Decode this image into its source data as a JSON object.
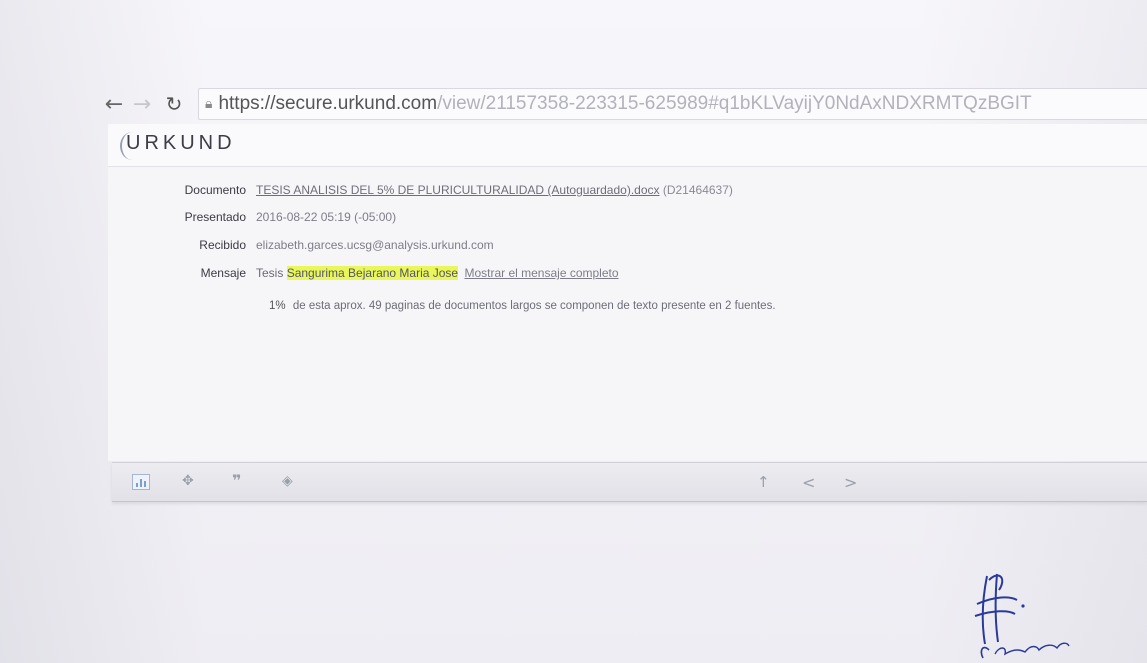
{
  "browser": {
    "back_icon": "back-arrow-icon",
    "forward_icon": "forward-arrow-icon",
    "reload_icon": "reload-icon",
    "url_host": "https://secure.urkund.com",
    "url_path": "/view/21157358-223315-625989#q1bKLVayijY0NdAxNDXRMTQzBGIT"
  },
  "app": {
    "logo": "URKUND"
  },
  "details": {
    "documento_label": "Documento",
    "documento_name": "TESIS ANALISIS DEL 5% DE PLURICULTURALIDAD (Autoguardado).docx",
    "documento_id": "(D21464637)",
    "presentado_label": "Presentado",
    "presentado_value": "2016-08-22 05:19 (-05:00)",
    "recibido_label": "Recibido",
    "recibido_value": "elizabeth.garces.ucsg@analysis.urkund.com",
    "mensaje_label": "Mensaje",
    "mensaje_prefix": "Tesis",
    "mensaje_highlight": "Sangurima Bejarano Maria Jose",
    "mensaje_link": "Mostrar el mensaje completo"
  },
  "summary": {
    "percent": "1%",
    "text": "de esta aprox. 49 paginas de documentos largos se componen de texto presente en 2 fuentes."
  },
  "toolbar": {
    "icons": [
      "chart-icon",
      "move-icon",
      "quote-icon",
      "tag-icon",
      "arrow-up-icon",
      "chevron-left-icon",
      "chevron-right-icon"
    ]
  },
  "signature": {
    "text": "R CASTILLO"
  },
  "colors": {
    "highlight": "#e9f75a",
    "background": "#f3f2f7"
  }
}
